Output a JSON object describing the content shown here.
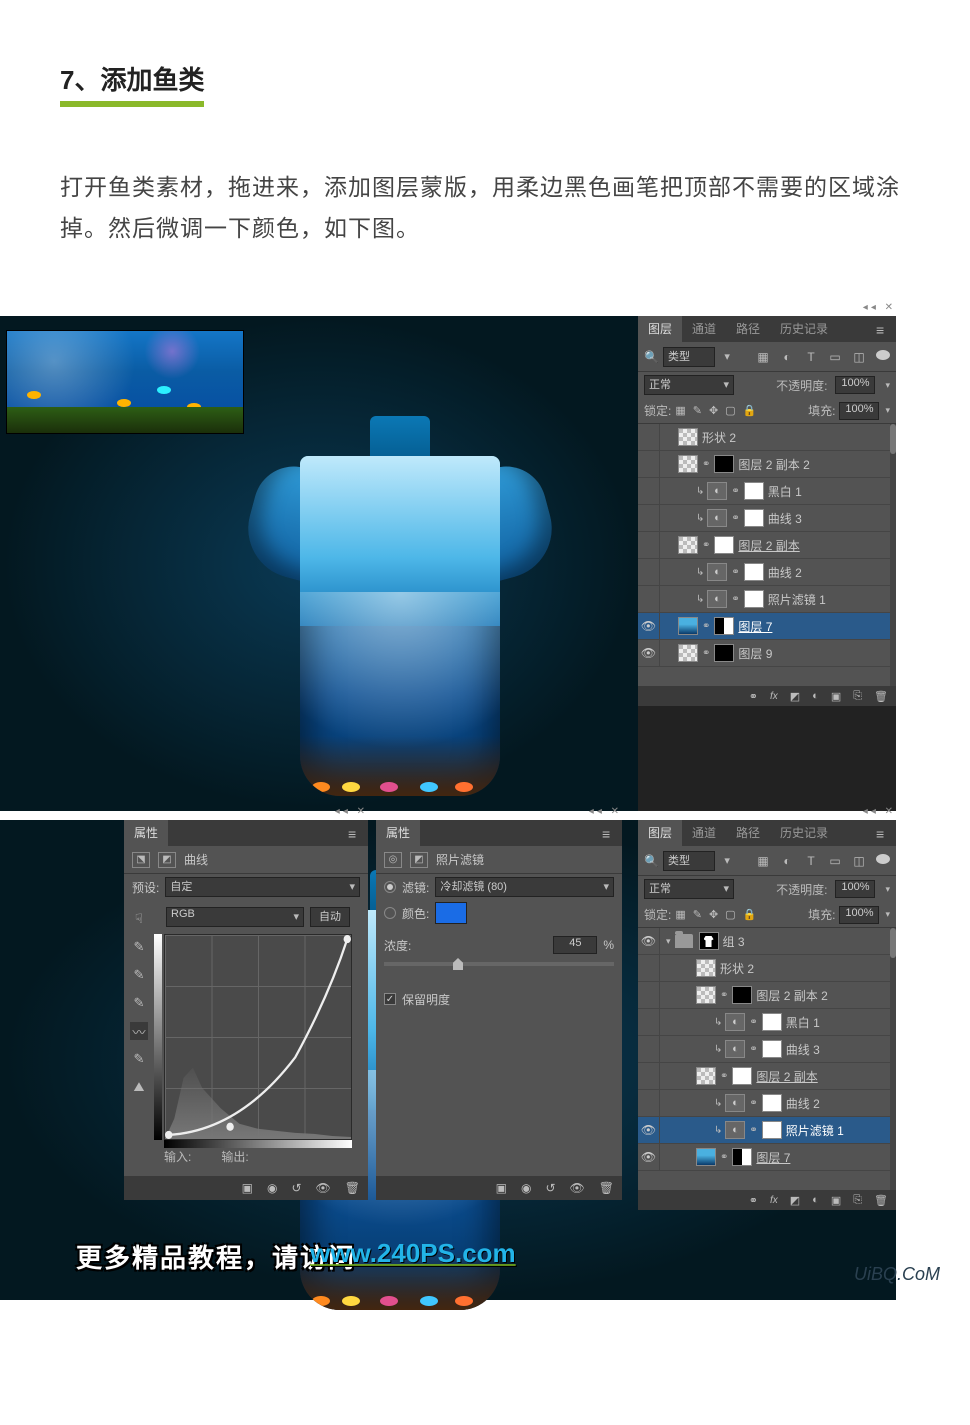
{
  "article": {
    "step_title": "7、添加鱼类",
    "step_desc": "打开鱼类素材，拖进来，添加图层蒙版，用柔边黑色画笔把顶部不需要的区域涂掉。然后微调一下颜色，如下图。"
  },
  "layers_panel": {
    "tabs": [
      "图层",
      "通道",
      "路径",
      "历史记录"
    ],
    "filter_type": "类型",
    "blend_mode": "正常",
    "opacity_label": "不透明度:",
    "opacity_value": "100%",
    "lock_label": "锁定:",
    "fill_label": "填充:",
    "fill_value": "100%",
    "bottom_fx": "fx"
  },
  "layers1": [
    {
      "vis": false,
      "indent": 1,
      "name": "形状 2",
      "thumbs": [
        "checker"
      ]
    },
    {
      "vis": false,
      "indent": 1,
      "name": "图层 2 副本 2",
      "thumbs": [
        "checker",
        "chain",
        "black"
      ]
    },
    {
      "vis": false,
      "indent": 2,
      "clip": true,
      "name": "黑白 1",
      "thumbs": [
        "adj",
        "chain",
        "white"
      ]
    },
    {
      "vis": false,
      "indent": 2,
      "clip": true,
      "name": "曲线 3",
      "thumbs": [
        "adj",
        "chain",
        "white"
      ]
    },
    {
      "vis": false,
      "indent": 1,
      "name": "图层 2 副本",
      "underlined": true,
      "thumbs": [
        "checker",
        "chain",
        "white"
      ]
    },
    {
      "vis": false,
      "indent": 2,
      "clip": true,
      "name": "曲线 2",
      "thumbs": [
        "adj",
        "chain",
        "white"
      ]
    },
    {
      "vis": false,
      "indent": 2,
      "clip": true,
      "name": "照片滤镜 1",
      "thumbs": [
        "adj",
        "chain",
        "white"
      ]
    },
    {
      "vis": true,
      "indent": 1,
      "name": "图层 7",
      "underlined": true,
      "selected": true,
      "thumbs": [
        "ocean",
        "chain",
        "half"
      ]
    },
    {
      "vis": true,
      "indent": 1,
      "name": "图层 9",
      "thumbs": [
        "checker",
        "chain",
        "black"
      ]
    }
  ],
  "layers2_group": {
    "name": "组 3"
  },
  "layers2": [
    {
      "vis": false,
      "indent": 2,
      "name": "形状 2",
      "thumbs": [
        "checker"
      ]
    },
    {
      "vis": false,
      "indent": 2,
      "name": "图层 2 副本 2",
      "thumbs": [
        "checker",
        "chain",
        "black"
      ]
    },
    {
      "vis": false,
      "indent": 3,
      "clip": true,
      "name": "黑白 1",
      "thumbs": [
        "adj",
        "chain",
        "white"
      ]
    },
    {
      "vis": false,
      "indent": 3,
      "clip": true,
      "name": "曲线 3",
      "thumbs": [
        "adj",
        "chain",
        "white"
      ]
    },
    {
      "vis": false,
      "indent": 2,
      "name": "图层 2 副本",
      "underlined": true,
      "thumbs": [
        "checker",
        "chain",
        "white"
      ]
    },
    {
      "vis": false,
      "indent": 3,
      "clip": true,
      "name": "曲线 2",
      "thumbs": [
        "adj",
        "chain",
        "white"
      ]
    },
    {
      "vis": true,
      "indent": 3,
      "clip": true,
      "name": "照片滤镜 1",
      "selected": true,
      "thumbs": [
        "adj",
        "chain",
        "white"
      ]
    },
    {
      "vis": true,
      "indent": 2,
      "name": "图层 7",
      "underlined": true,
      "thumbs": [
        "ocean",
        "chain",
        "half"
      ]
    }
  ],
  "curves_panel": {
    "title": "属性",
    "adj_name": "曲线",
    "preset_label": "预设:",
    "preset_value": "自定",
    "channel_value": "RGB",
    "auto_btn": "自动",
    "input_label": "输入:",
    "output_label": "输出:"
  },
  "filter_panel": {
    "title": "属性",
    "adj_name": "照片滤镜",
    "filter_label": "滤镜:",
    "filter_value": "冷却滤镜 (80)",
    "color_label": "颜色:",
    "color_hex": "#1a6ce6",
    "density_label": "浓度:",
    "density_value": "45",
    "density_unit": "%",
    "preserve_label": "保留明度"
  },
  "footer": {
    "text": "更多精品教程，请访问",
    "link": "www.240PS.com",
    "watermark": "UiBQ.CoM"
  }
}
